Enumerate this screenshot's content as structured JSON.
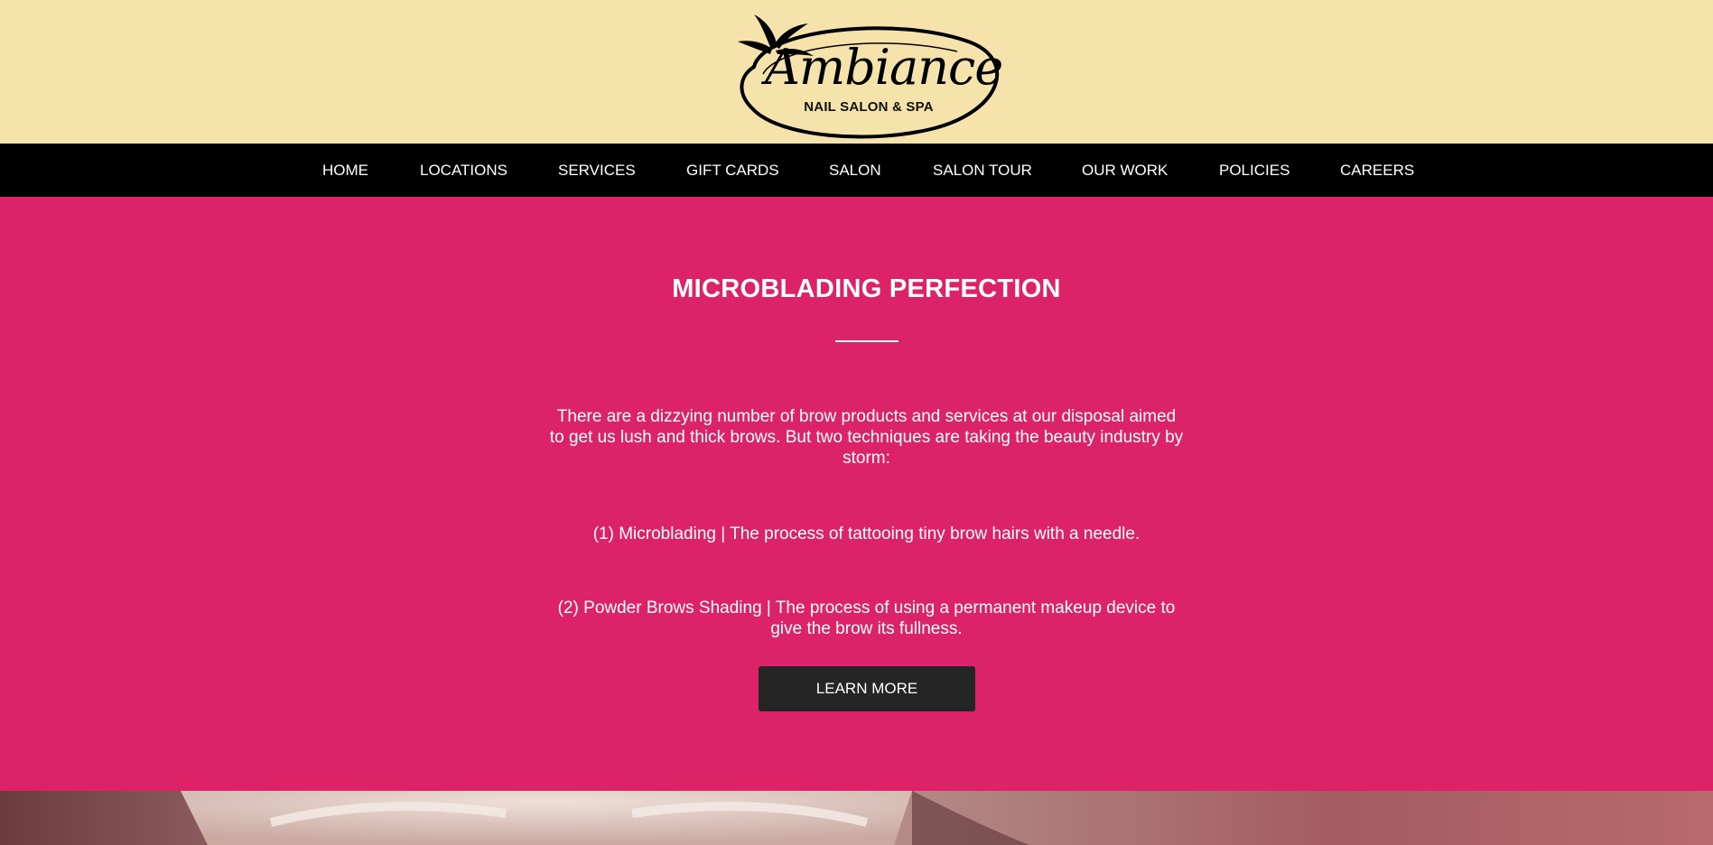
{
  "brand": {
    "logo_main": "Ambiance",
    "logo_sub": "NAIL SALON & SPA"
  },
  "nav": {
    "items": [
      {
        "label": "HOME"
      },
      {
        "label": "LOCATIONS"
      },
      {
        "label": "SERVICES"
      },
      {
        "label": "GIFT CARDS"
      },
      {
        "label": "SALON"
      },
      {
        "label": "SALON TOUR"
      },
      {
        "label": "OUR WORK"
      },
      {
        "label": "POLICIES"
      },
      {
        "label": "CAREERS"
      }
    ]
  },
  "hero": {
    "title": "MICROBLADING PERFECTION",
    "intro": "There are a dizzying number of brow products and services at our disposal aimed to get us lush and thick brows. But two techniques are taking the beauty industry by storm:",
    "point1": "(1) Microblading | The process of tattooing tiny brow hairs with a needle.",
    "point2": "(2) Powder Brows Shading | The process of using a permanent makeup device to give the brow its fullness.",
    "button_label": "LEARN MORE"
  },
  "colors": {
    "header_bg": "#f6e3ab",
    "nav_bg": "#000000",
    "hero_bg": "#dc2368",
    "button_bg": "#252525"
  }
}
